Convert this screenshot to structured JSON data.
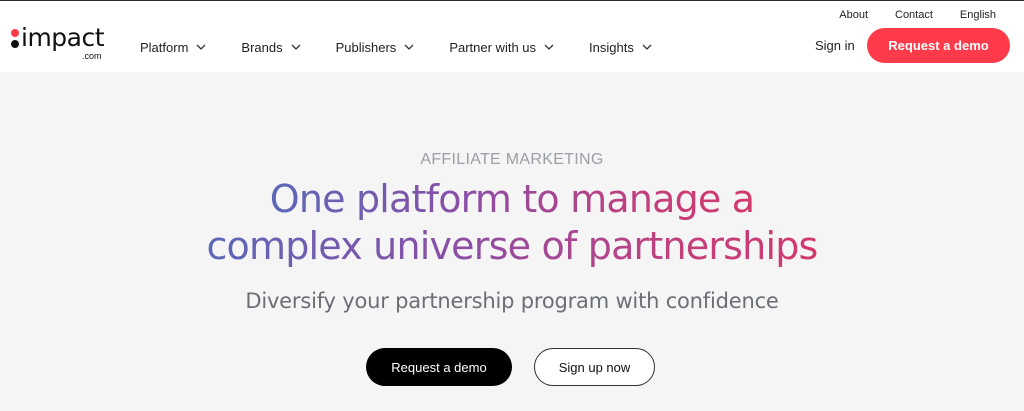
{
  "brand": {
    "name": "impact",
    "suffix": ".com",
    "dot_top_color": "#ff3a4a",
    "dot_bottom_color": "#111111"
  },
  "nav": {
    "items": [
      {
        "label": "Platform",
        "icon": "chevron-down-icon"
      },
      {
        "label": "Brands",
        "icon": "chevron-down-icon"
      },
      {
        "label": "Publishers",
        "icon": "chevron-down-icon"
      },
      {
        "label": "Partner with us",
        "icon": "chevron-down-icon"
      },
      {
        "label": "Insights",
        "icon": "chevron-down-icon"
      }
    ]
  },
  "utility": {
    "about": "About",
    "contact": "Contact",
    "language": "English"
  },
  "header_actions": {
    "signin": "Sign in",
    "request_demo": "Request a demo"
  },
  "hero": {
    "eyebrow": "AFFILIATE MARKETING",
    "headline_line1": "One platform to manage a",
    "headline_line2": "complex universe of partnerships",
    "subheadline": "Diversify your partnership program with confidence",
    "primary_cta": "Request a demo",
    "secondary_cta": "Sign up now"
  },
  "colors": {
    "accent": "#ff3a4a",
    "gradient_start": "#5b67b8",
    "gradient_end": "#d4376c",
    "background": "#f5f5f6"
  }
}
